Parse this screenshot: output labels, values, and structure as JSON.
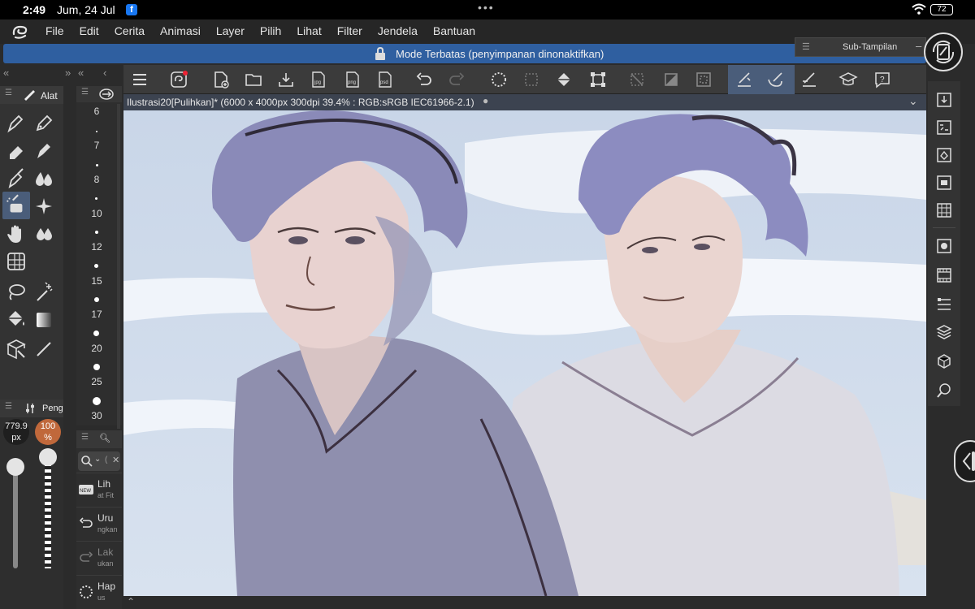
{
  "status_bar": {
    "time": "2:49",
    "date": "Jum, 24 Jul",
    "battery": "72"
  },
  "menu": [
    "File",
    "Edit",
    "Cerita",
    "Animasi",
    "Layer",
    "Pilih",
    "Lihat",
    "Filter",
    "Jendela",
    "Bantuan"
  ],
  "banner": {
    "text": "Mode Terbatas (penyimpanan dinonaktifkan)"
  },
  "sub_view": {
    "title": "Sub-Tampilan"
  },
  "tab": {
    "title": "Ilustrasi20[Pulihkan]* (6000 x 4000px 300dpi 39.4% : RGB:sRGB IEC61966-2.1)"
  },
  "tool_palette": {
    "title": "Alat"
  },
  "brush_sizes": [
    "6",
    "7",
    "8",
    "10",
    "12",
    "15",
    "17",
    "20",
    "25",
    "30"
  ],
  "sliders": {
    "header": "Peng",
    "size_value": "779.9",
    "size_unit": "px",
    "opacity_value": "100",
    "opacity_unit": "%"
  },
  "history": {
    "search_placeholder": "(",
    "items": [
      {
        "label": "Lih",
        "sub": "at Fit"
      },
      {
        "label": "Uru",
        "sub": "ngkan"
      },
      {
        "label": "Lak",
        "sub": "ukan"
      },
      {
        "label": "Hap",
        "sub": "us"
      }
    ]
  },
  "colors": {
    "main": "#c0683b",
    "sub": "#2e4a9a",
    "accent": "#2f5fa0",
    "active_tool": "#4a5d7a"
  }
}
